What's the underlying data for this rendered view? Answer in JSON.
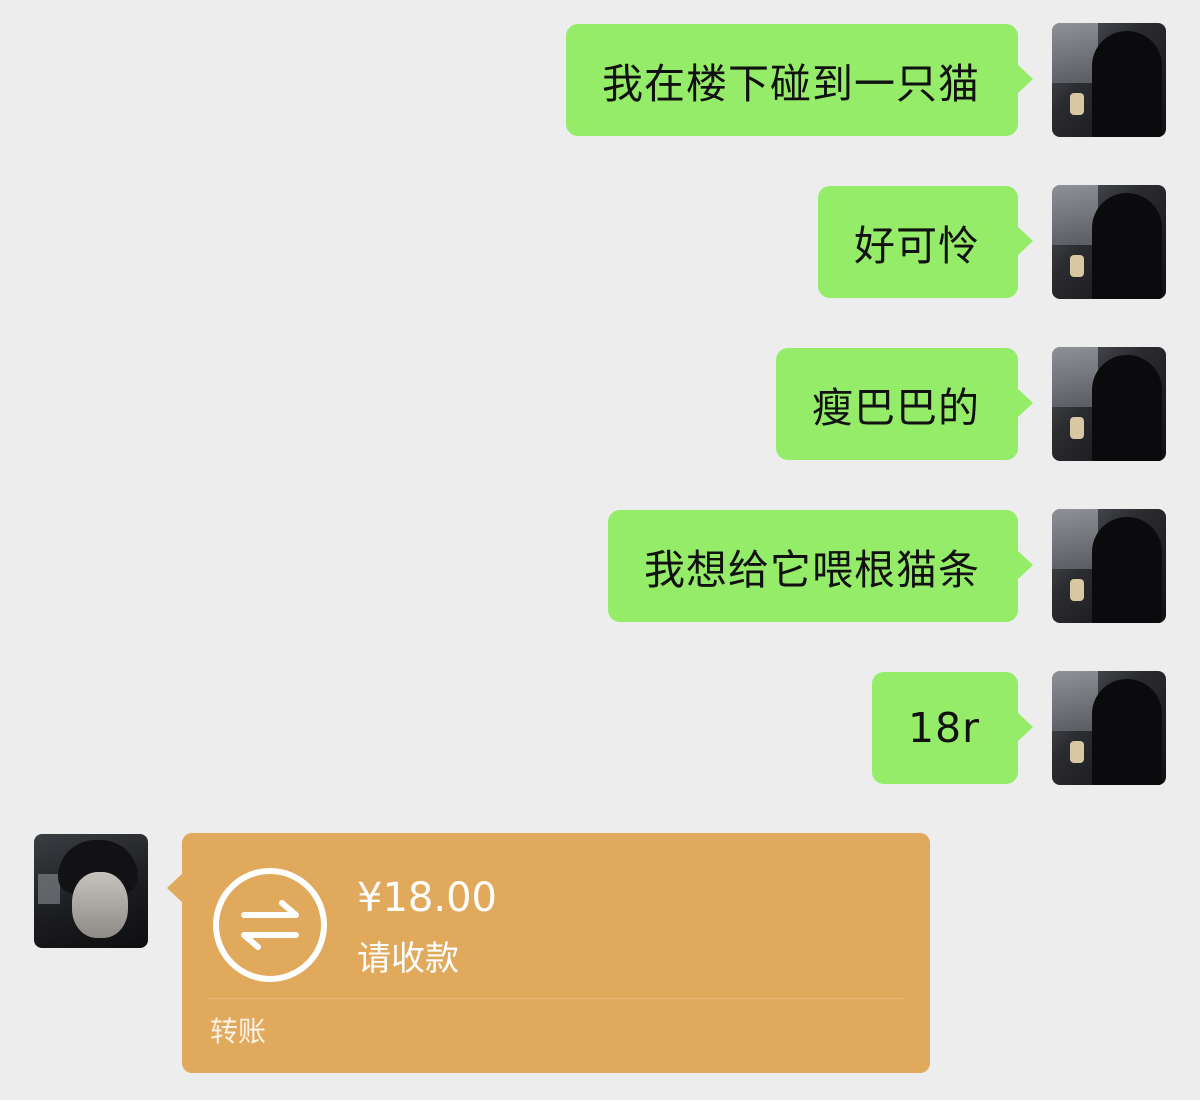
{
  "messages_out": [
    {
      "text": "我在楼下碰到一只猫"
    },
    {
      "text": "好可怜"
    },
    {
      "text": "瘦巴巴的"
    },
    {
      "text": "我想给它喂根猫条"
    },
    {
      "text": "18r"
    }
  ],
  "transfer": {
    "amount": "¥18.00",
    "status": "请收款",
    "type_label": "转账",
    "icon": "transfer-arrows-icon"
  },
  "colors": {
    "background": "#ededed",
    "outgoing_bubble": "#95ec69",
    "transfer_card": "#e0a95c"
  }
}
